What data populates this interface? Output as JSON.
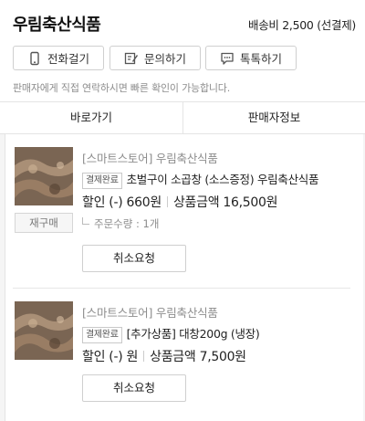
{
  "header": {
    "seller_name": "우림축산식품",
    "shipping": "배송비 2,500 (선결제)"
  },
  "contact_buttons": [
    {
      "label": "전화걸기",
      "icon": "phone-icon"
    },
    {
      "label": "문의하기",
      "icon": "edit-icon"
    },
    {
      "label": "톡톡하기",
      "icon": "chat-icon"
    }
  ],
  "notice": "판매자에게 직접 연락하시면 빠른 확인이 가능합니다.",
  "tabs": [
    {
      "label": "바로가기"
    },
    {
      "label": "판매자정보"
    }
  ],
  "items": [
    {
      "store": "[스마트스토어] 우림축산식품",
      "badge": "결제완료",
      "name": "초벌구이 소곱창 (소스증정) 우림축산식품",
      "discount": "할인 (-) 660원",
      "amount": "상품금액 16,500원",
      "quantity": "주문수량 : 1개",
      "reorder_label": "재구매",
      "cancel_label": "취소요청"
    },
    {
      "store": "[스마트스토어] 우림축산식품",
      "badge": "결제완료",
      "name": "[추가상품] 대창200g (냉장)",
      "discount": "할인 (-) 원",
      "amount": "상품금액 7,500원",
      "cancel_label": "취소요청"
    }
  ]
}
